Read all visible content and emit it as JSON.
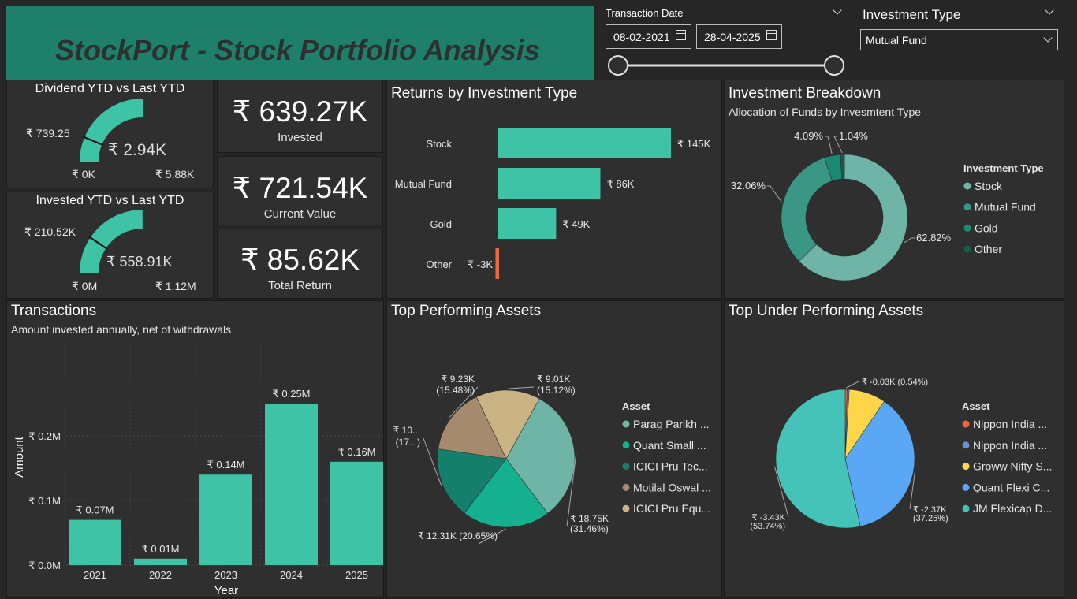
{
  "header": {
    "title": "StockPort - Stock Portfolio Analysis"
  },
  "filters": {
    "transaction_date_label": "Transaction Date",
    "start_date": "08-02-2021",
    "end_date": "28-04-2025",
    "investment_type_label": "Investment Type",
    "investment_type_value": "Mutual Fund"
  },
  "gauges": {
    "dividend": {
      "title": "Dividend YTD vs Last YTD",
      "value_label": "₹ 2.94K",
      "target_label": "₹ 739.25",
      "min_label": "₹ 0K",
      "max_label": "₹ 5.88K",
      "value": 2.94,
      "target": 0.73925,
      "min": 0,
      "max": 5.88
    },
    "invested": {
      "title": "Invested YTD vs Last YTD",
      "value_label": "₹ 558.91K",
      "target_label": "₹ 210.52K",
      "min_label": "₹ 0M",
      "max_label": "₹ 1.12M",
      "value": 558.91,
      "target": 210.52,
      "min": 0,
      "max": 1120
    }
  },
  "kpis": {
    "invested": {
      "value": "₹ 639.27K",
      "label": "Invested"
    },
    "current": {
      "value": "₹ 721.54K",
      "label": "Current Value"
    },
    "total_return": {
      "value": "₹ 85.62K",
      "label": "Total Return"
    }
  },
  "panel_titles": {
    "returns": "Returns by Investment Type",
    "breakdown": "Investment Breakdown",
    "breakdown_sub": "Allocation of Funds by Invesmtent Type",
    "transactions": "Transactions",
    "transactions_sub": "Amount invested annually, net of withdrawals",
    "top": "Top Performing Assets",
    "under": "Top Under Performing Assets"
  },
  "colors": {
    "teal": "#3fc3a6",
    "negative": "#e8683f",
    "banner": "#1e7f6b"
  },
  "chart_data": [
    {
      "type": "bar",
      "title": "Returns by Investment Type",
      "orientation": "horizontal",
      "categories": [
        "Stock",
        "Mutual Fund",
        "Gold",
        "Other"
      ],
      "values": [
        145,
        86,
        49,
        -3
      ],
      "labels": [
        "₹ 145K",
        "₹ 86K",
        "₹ 49K",
        "₹ -3K"
      ],
      "unit": "K"
    },
    {
      "type": "pie",
      "title": "Investment Breakdown",
      "donut": true,
      "legend_title": "Investment Type",
      "legend_position": "right",
      "categories": [
        "Stock",
        "Mutual Fund",
        "Gold",
        "Other"
      ],
      "values": [
        62.82,
        32.06,
        4.09,
        1.04
      ],
      "labels": [
        "62.82%",
        "32.06%",
        "4.09%",
        "1.04%"
      ],
      "colors": [
        "#6eb5a7",
        "#3a9786",
        "#1a8a72",
        "#155c4e"
      ]
    },
    {
      "type": "bar",
      "title": "Transactions",
      "xlabel": "Year",
      "ylabel": "Amount",
      "categories": [
        "2021",
        "2022",
        "2023",
        "2024",
        "2025"
      ],
      "values": [
        0.07,
        0.01,
        0.14,
        0.25,
        0.16
      ],
      "labels": [
        "₹ 0.07M",
        "₹ 0.01M",
        "₹ 0.14M",
        "₹ 0.25M",
        "₹ 0.16M"
      ],
      "ylim": [
        0,
        0.25
      ],
      "yticks": [
        0,
        0.1,
        0.2
      ],
      "ytick_labels": [
        "₹ 0.0M",
        "₹ 0.1M",
        "₹ 0.2M"
      ],
      "grid": true
    },
    {
      "type": "pie",
      "title": "Top Performing Assets",
      "legend_title": "Asset",
      "legend_position": "right",
      "categories": [
        "Parag Parikh ...",
        "Quant Small ...",
        "ICICI Pru Tec...",
        "Motilal Oswal ...",
        "ICICI Pru Equ..."
      ],
      "values": [
        18.75,
        12.31,
        10.0,
        9.23,
        9.01
      ],
      "labels": [
        "₹ 18.75K (31.46%)",
        "₹ 12.31K (20.65%)",
        "₹ 10... (17...)",
        "₹ 9.23K (15.48%)",
        "₹ 9.01K (15.12%)"
      ],
      "colors": [
        "#6eb5a7",
        "#15b08f",
        "#14806c",
        "#a58a6d",
        "#c9b382"
      ]
    },
    {
      "type": "pie",
      "title": "Top Under Performing Assets",
      "legend_title": "Asset",
      "legend_position": "right",
      "categories": [
        "Nippon India ...",
        "Nippon India ...",
        "Groww Nifty S...",
        "Quant Flexi C...",
        "JM Flexicap D..."
      ],
      "values": [
        0.03,
        0.03,
        0.55,
        2.37,
        3.43
      ],
      "labels": [
        "₹ -0.03K (0.54%)",
        "",
        "",
        "₹ -2.37K (37.25%)",
        "₹ -3.43K (53.74%)"
      ],
      "colors": [
        "#e8683f",
        "#6b8fd6",
        "#ffd54a",
        "#5aa7f5",
        "#45c3b8"
      ]
    }
  ]
}
